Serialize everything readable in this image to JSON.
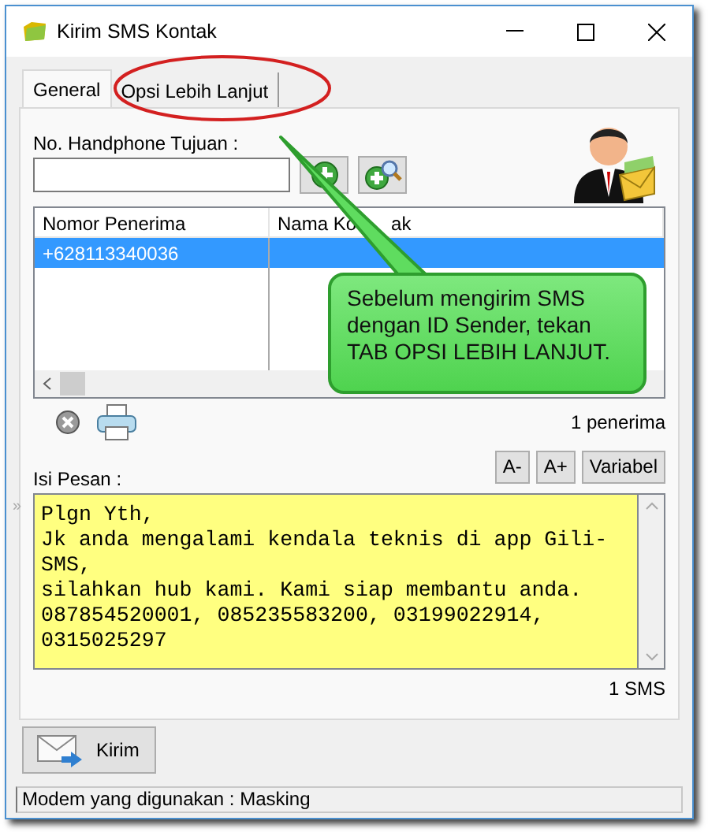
{
  "window": {
    "title": "Kirim SMS Kontak"
  },
  "tabs": [
    {
      "label": "General",
      "selected": true
    },
    {
      "label": "Opsi Lebih Lanjut",
      "selected": false
    }
  ],
  "phone": {
    "label": "No. Handphone Tujuan :"
  },
  "recipients": {
    "columns": [
      {
        "label": "Nomor Penerima"
      },
      {
        "label": "Nama Ko",
        "tail": "ak"
      }
    ],
    "rows": [
      {
        "number": "+628113340036",
        "selected": true
      }
    ],
    "count": "1 penerima"
  },
  "message": {
    "label": "Isi Pesan :",
    "buttons": [
      "A-",
      "A+",
      "Variabel"
    ],
    "margin_mark": "»",
    "lines": [
      "Plgn Yth,",
      "Jk anda mengalami kendala teknis di app Gili-",
      "SMS,",
      "silahkan hub kami. Kami siap membantu anda.",
      "087854520001, 085235583200, 03199022914,",
      "0315025297"
    ],
    "sms_count": "1 SMS"
  },
  "send_button": {
    "label": "Kirim"
  },
  "status_bar": "Modem yang digunakan : Masking",
  "callout": {
    "lines": [
      "Sebelum mengirim SMS",
      "dengan ID Sender, tekan",
      "TAB OPSI LEBIH LANJUT."
    ]
  }
}
